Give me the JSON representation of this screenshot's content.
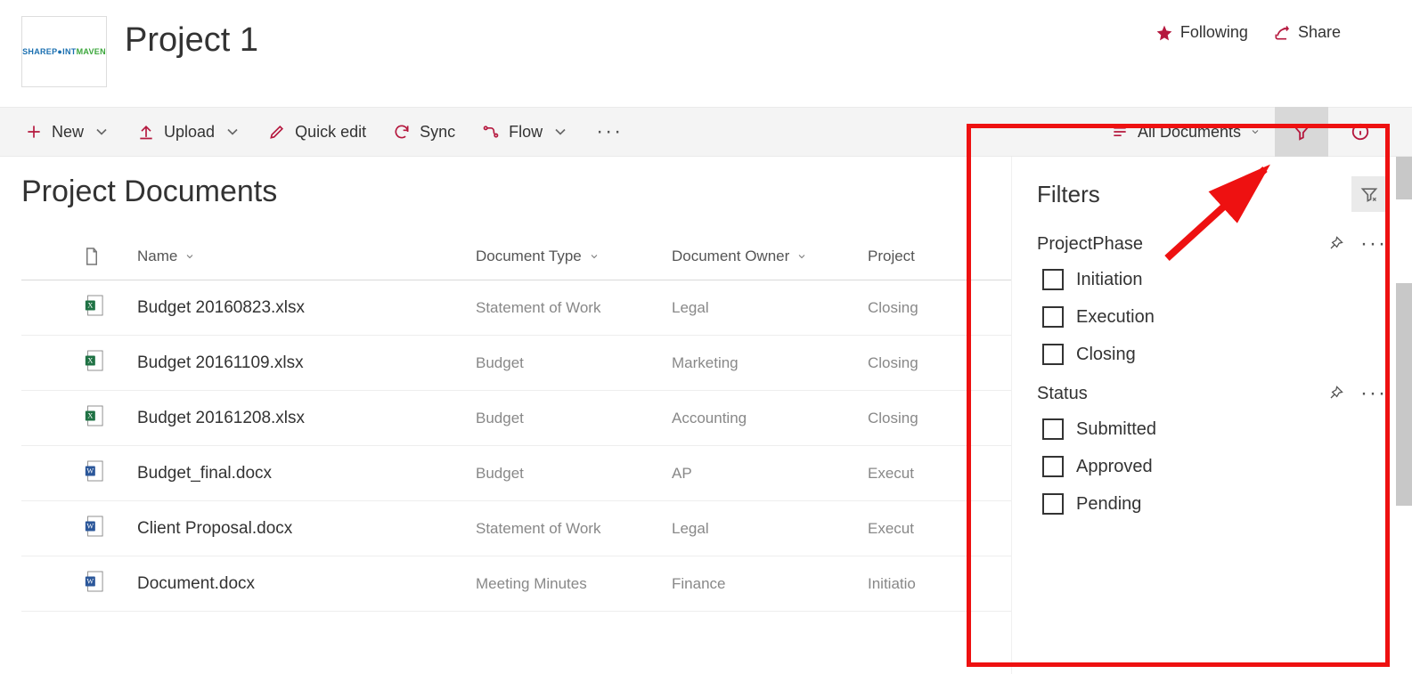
{
  "header": {
    "site_title": "Project 1",
    "logo_text_1": "SHAREP",
    "logo_text_2": "INT",
    "logo_text_3": "MAVEN",
    "following_label": "Following",
    "share_label": "Share"
  },
  "toolbar": {
    "new_label": "New",
    "upload_label": "Upload",
    "quickedit_label": "Quick edit",
    "sync_label": "Sync",
    "flow_label": "Flow",
    "view_label": "All Documents"
  },
  "library": {
    "title": "Project Documents",
    "columns": {
      "name": "Name",
      "doctype": "Document Type",
      "owner": "Document Owner",
      "phase": "Project"
    },
    "rows": [
      {
        "icon": "excel",
        "name": "Budget 20160823.xlsx",
        "doctype": "Statement of Work",
        "owner": "Legal",
        "phase": "Closing"
      },
      {
        "icon": "excel",
        "name": "Budget 20161109.xlsx",
        "doctype": "Budget",
        "owner": "Marketing",
        "phase": "Closing"
      },
      {
        "icon": "excel",
        "name": "Budget 20161208.xlsx",
        "doctype": "Budget",
        "owner": "Accounting",
        "phase": "Closing"
      },
      {
        "icon": "word",
        "name": "Budget_final.docx",
        "doctype": "Budget",
        "owner": "AP",
        "phase": "Execut"
      },
      {
        "icon": "word",
        "name": "Client Proposal.docx",
        "doctype": "Statement of Work",
        "owner": "Legal",
        "phase": "Execut"
      },
      {
        "icon": "word",
        "name": "Document.docx",
        "doctype": "Meeting Minutes",
        "owner": "Finance",
        "phase": "Initiatio"
      }
    ]
  },
  "filters": {
    "title": "Filters",
    "sections": [
      {
        "title": "ProjectPhase",
        "options": [
          "Initiation",
          "Execution",
          "Closing"
        ]
      },
      {
        "title": "Status",
        "options": [
          "Submitted",
          "Approved",
          "Pending"
        ]
      }
    ]
  }
}
